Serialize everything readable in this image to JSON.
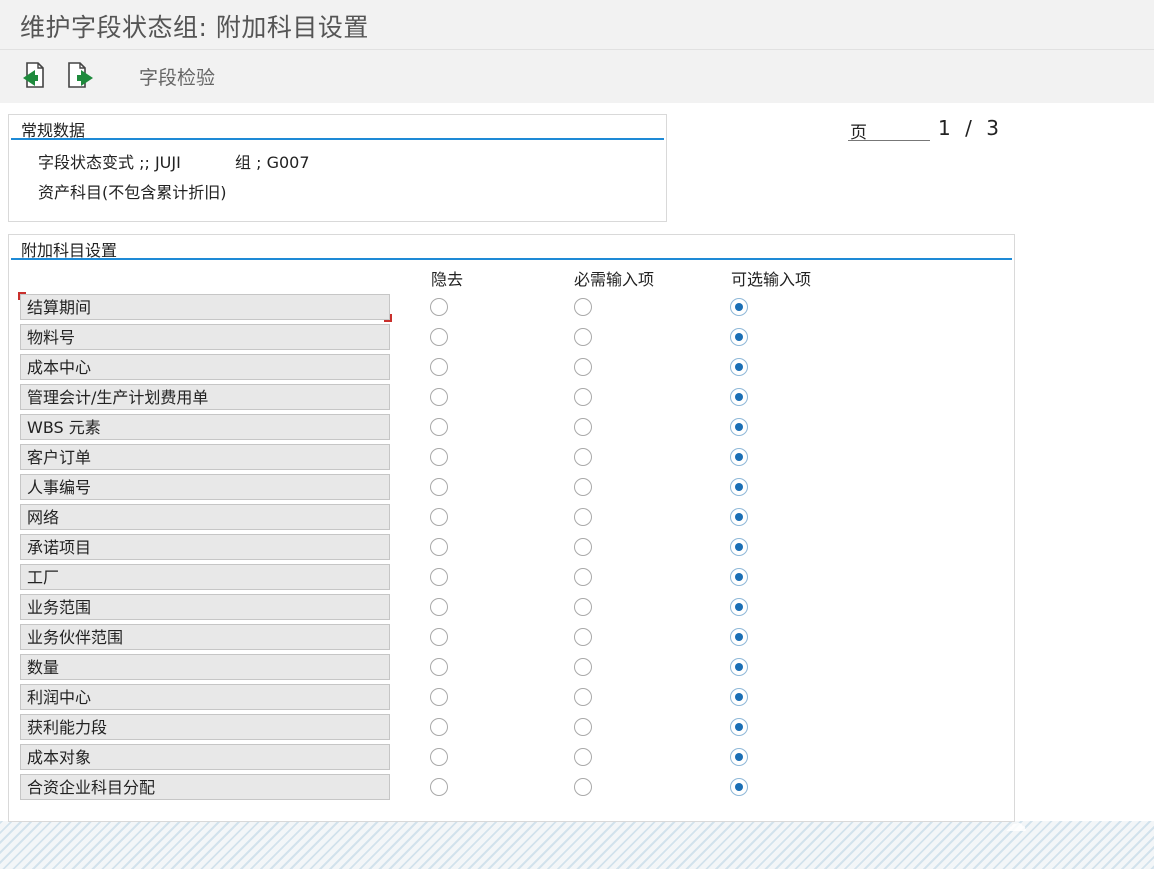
{
  "window": {
    "title": "维护字段状态组: 附加科目设置"
  },
  "toolbar": {
    "back_icon": "back-exit-icon",
    "next_icon": "next-page-icon",
    "field_check_label": "字段检验"
  },
  "general_data": {
    "title": "常规数据",
    "variant_label": "字段状态变式 ;; JUJI",
    "group_label": "组 ; G007",
    "description": "资产科目(不包含累计折旧)"
  },
  "pager": {
    "label": "页",
    "current": "1",
    "separator": "/",
    "total": "3"
  },
  "additional": {
    "title": "附加科目设置",
    "columns": {
      "hide": "隐去",
      "required": "必需输入项",
      "optional": "可选输入项"
    },
    "rows": [
      {
        "label": "结算期间",
        "selected": "optional"
      },
      {
        "label": "物料号",
        "selected": "optional"
      },
      {
        "label": "成本中心",
        "selected": "optional"
      },
      {
        "label": "管理会计/生产计划费用单",
        "selected": "optional"
      },
      {
        "label": "WBS 元素",
        "selected": "optional"
      },
      {
        "label": "客户订单",
        "selected": "optional"
      },
      {
        "label": "人事编号",
        "selected": "optional"
      },
      {
        "label": "网络",
        "selected": "optional"
      },
      {
        "label": "承诺项目",
        "selected": "optional"
      },
      {
        "label": "工厂",
        "selected": "optional"
      },
      {
        "label": "业务范围",
        "selected": "optional"
      },
      {
        "label": "业务伙伴范围",
        "selected": "optional"
      },
      {
        "label": "数量",
        "selected": "optional"
      },
      {
        "label": "利润中心",
        "selected": "optional"
      },
      {
        "label": "获利能力段",
        "selected": "optional"
      },
      {
        "label": "成本对象",
        "selected": "optional"
      },
      {
        "label": "合资企业科目分配",
        "selected": "optional"
      }
    ]
  },
  "colors": {
    "accent_line": "#1e8ad6",
    "radio_dot": "#1b6fb5",
    "focus_marker": "#c9302c"
  }
}
